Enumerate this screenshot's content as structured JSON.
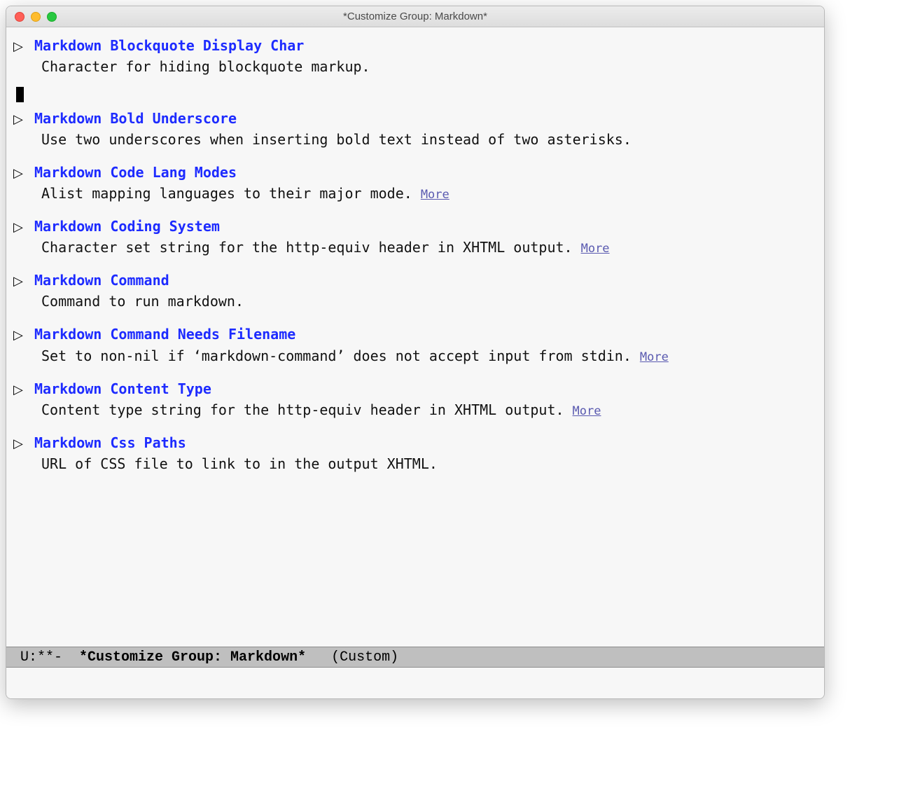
{
  "window": {
    "title": "*Customize Group: Markdown*"
  },
  "items": [
    {
      "name": "Markdown Blockquote Display Char",
      "desc": "Character for hiding blockquote markup.",
      "more": false,
      "cursor_after": true
    },
    {
      "name": "Markdown Bold Underscore",
      "desc": "Use two underscores when inserting bold text instead of two asterisks.",
      "more": false
    },
    {
      "name": "Markdown Code Lang Modes",
      "desc": "Alist mapping languages to their major mode.",
      "more": true
    },
    {
      "name": "Markdown Coding System",
      "desc": "Character set string for the http-equiv header in XHTML output.",
      "more": true
    },
    {
      "name": "Markdown Command",
      "desc": "Command to run markdown.",
      "more": false
    },
    {
      "name": "Markdown Command Needs Filename",
      "desc": "Set to non-nil if ‘markdown-command’ does not accept input from stdin.",
      "more": true
    },
    {
      "name": "Markdown Content Type",
      "desc": "Content type string for the http-equiv header in XHTML output.",
      "more": true
    },
    {
      "name": "Markdown Css Paths",
      "desc": "URL of CSS file to link to in the output XHTML.",
      "more": false
    }
  ],
  "more_label": "More",
  "triangle": "▷",
  "modeline": {
    "left": " U:**-  ",
    "buffer": "*Customize Group: Markdown*",
    "mode": "   (Custom)"
  }
}
